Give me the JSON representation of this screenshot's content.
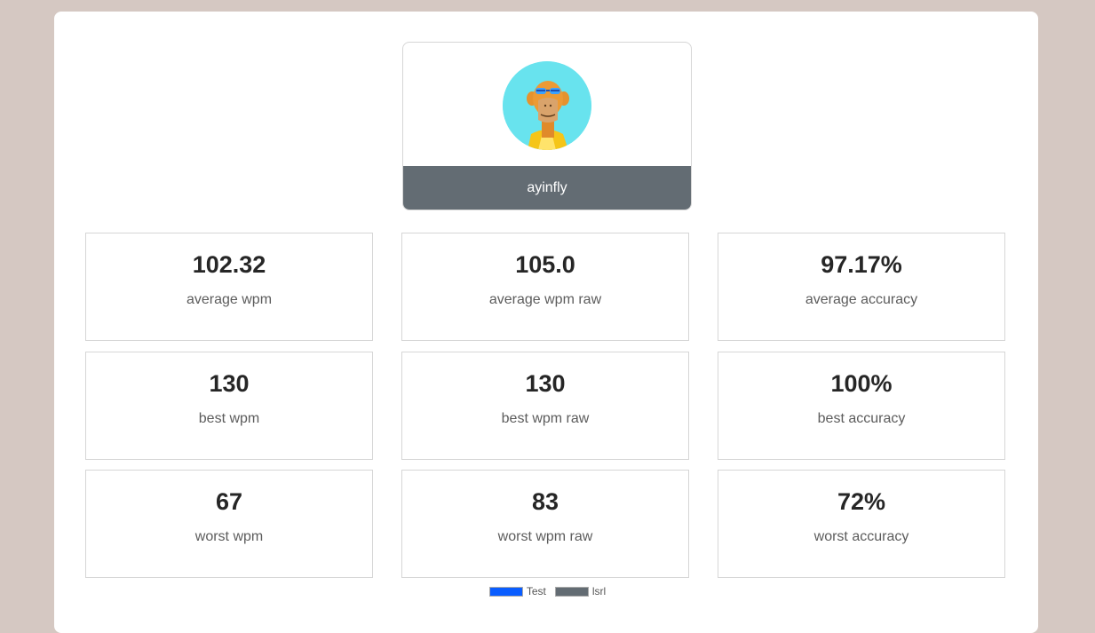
{
  "profile": {
    "username": "ayinfly",
    "avatar_icon": "ape-avatar-icon"
  },
  "stats": [
    {
      "value": "102.32",
      "label": "average wpm"
    },
    {
      "value": "105.0",
      "label": "average wpm raw"
    },
    {
      "value": "97.17%",
      "label": "average accuracy"
    },
    {
      "value": "130",
      "label": "best wpm"
    },
    {
      "value": "130",
      "label": "best wpm raw"
    },
    {
      "value": "100%",
      "label": "best accuracy"
    },
    {
      "value": "67",
      "label": "worst wpm"
    },
    {
      "value": "83",
      "label": "worst wpm raw"
    },
    {
      "value": "72%",
      "label": "worst accuracy"
    }
  ],
  "legend": {
    "items": [
      {
        "label": "Test",
        "color": "#0a5dff"
      },
      {
        "label": "lsrl",
        "color": "#636c73"
      }
    ]
  },
  "colors": {
    "background": "#d5c8c2",
    "username_bar": "#636c73",
    "avatar_bg": "#68e3ee"
  }
}
